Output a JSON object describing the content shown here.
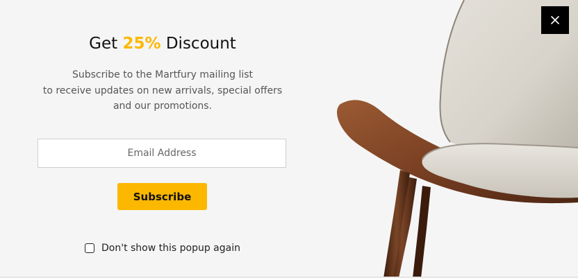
{
  "popup": {
    "title_prefix": "Get ",
    "title_accent": "25%",
    "title_suffix": " Discount",
    "description_lines": [
      "Subscribe to the Martfury mailing list",
      "to receive updates on new arrivals, special offers",
      "and our promotions."
    ],
    "email_placeholder": "Email Address",
    "subscribe_label": "Subscribe",
    "dont_show_label": "Don't show this popup again",
    "dont_show_checked": false,
    "close_icon": "close-icon",
    "image": "chair-image"
  },
  "colors": {
    "accent": "#fcb800",
    "background": "#f5f5f5",
    "close_bg": "#000000"
  }
}
